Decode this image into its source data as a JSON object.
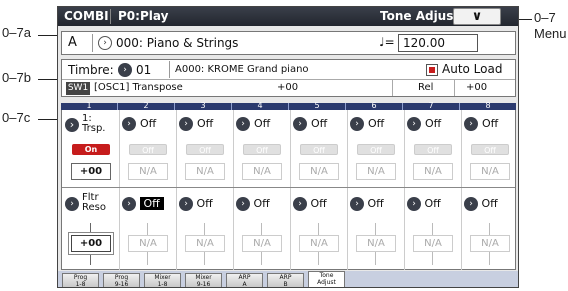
{
  "annotations": {
    "row_a": "0–7a",
    "row_b": "0–7b",
    "row_c": "0–7c",
    "menu": "0–7",
    "menu_sub": "Menu"
  },
  "header": {
    "mode": "COMBI",
    "page": "P0:Play",
    "tab_title": "Tone Adjust",
    "menu_glyph": "∨"
  },
  "program": {
    "bank": "A",
    "number_name": "000: Piano & Strings",
    "tempo_symbol": "♩=",
    "tempo": "120.00"
  },
  "timbre": {
    "label": "Timbre:",
    "number": "01",
    "program": "A000: KROME Grand piano",
    "auto_load_label": "Auto Load",
    "sw_label": "SW1",
    "sw_function": "[OSC1] Transpose",
    "sw_value": "+00",
    "sw_mode": "Rel",
    "sw_mode_value": "+00"
  },
  "timbre_numbers": [
    "1",
    "2",
    "3",
    "4",
    "5",
    "6",
    "7",
    "8"
  ],
  "controls_row1": {
    "name_line1": "1:",
    "name_line2": "Trsp.",
    "cells": [
      {
        "label": "",
        "switch": "On",
        "value": "+00"
      },
      {
        "label": "Off",
        "switch": "Off",
        "value": "N/A"
      },
      {
        "label": "Off",
        "switch": "Off",
        "value": "N/A"
      },
      {
        "label": "Off",
        "switch": "Off",
        "value": "N/A"
      },
      {
        "label": "Off",
        "switch": "Off",
        "value": "N/A"
      },
      {
        "label": "Off",
        "switch": "Off",
        "value": "N/A"
      },
      {
        "label": "Off",
        "switch": "Off",
        "value": "N/A"
      },
      {
        "label": "Off",
        "switch": "Off",
        "value": "N/A"
      }
    ]
  },
  "controls_row2": {
    "name_line1": "Fltr",
    "name_line2": "Reso",
    "cells": [
      {
        "label": "",
        "value": "+00"
      },
      {
        "label": "Off",
        "value": "N/A"
      },
      {
        "label": "Off",
        "value": "N/A"
      },
      {
        "label": "Off",
        "value": "N/A"
      },
      {
        "label": "Off",
        "value": "N/A"
      },
      {
        "label": "Off",
        "value": "N/A"
      },
      {
        "label": "Off",
        "value": "N/A"
      },
      {
        "label": "Off",
        "value": "N/A"
      }
    ]
  },
  "tabs": [
    {
      "line1": "Prog",
      "line2": "1-8"
    },
    {
      "line1": "Prog",
      "line2": "9-16"
    },
    {
      "line1": "Mixer",
      "line2": "1-8"
    },
    {
      "line1": "Mixer",
      "line2": "9-16"
    },
    {
      "line1": "ARP",
      "line2": "A"
    },
    {
      "line1": "ARP",
      "line2": "B"
    },
    {
      "line1": "Tone",
      "line2": "Adjust"
    }
  ],
  "colors": {
    "header_bg": "#22262e",
    "timbre_bar": "#2b3a6e",
    "switch_on": "#c61c1c",
    "auto_load": "#c81e1e"
  }
}
